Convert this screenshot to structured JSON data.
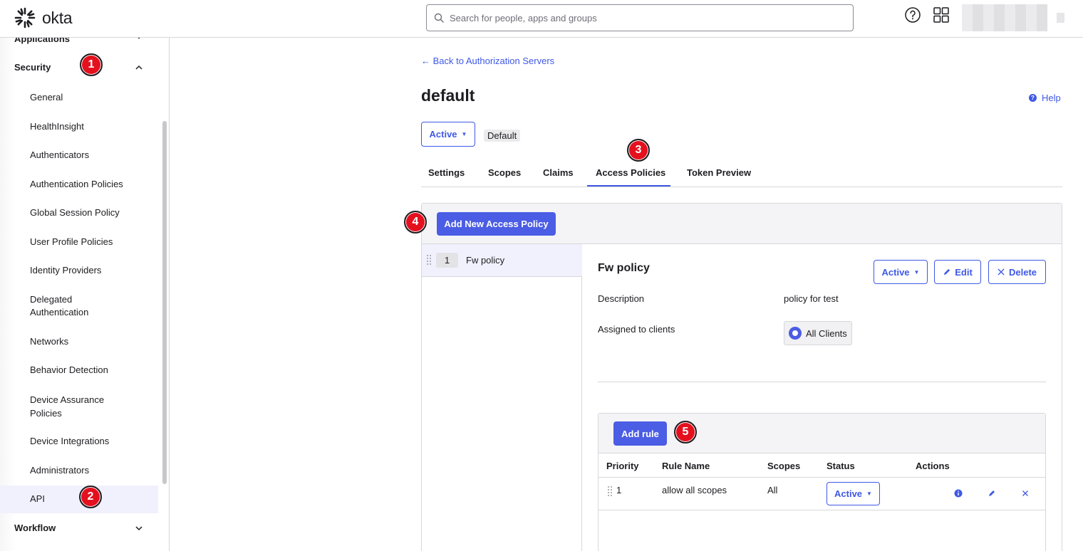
{
  "header": {
    "logo_text": "okta",
    "search_placeholder": "Search for people, apps and groups"
  },
  "sidebar": {
    "cut_section": "Applications",
    "security_label": "Security",
    "items": [
      "General",
      "HealthInsight",
      "Authenticators",
      "Authentication Policies",
      "Global Session Policy",
      "User Profile Policies",
      "Identity Providers",
      "Delegated Authentication",
      "Networks",
      "Behavior Detection",
      "Device Assurance Policies",
      "Device Integrations",
      "Administrators",
      "API"
    ],
    "active_item": "API",
    "workflow_label": "Workflow"
  },
  "badges": [
    "1",
    "2",
    "3",
    "4",
    "5"
  ],
  "main": {
    "back_link": "← Back to Authorization Servers",
    "title": "default",
    "help_label": "Help",
    "status_button": "Active",
    "default_tag": "Default",
    "tabs": [
      "Settings",
      "Scopes",
      "Claims",
      "Access Policies",
      "Token Preview"
    ],
    "active_tab": "Access Policies",
    "add_policy_button": "Add New Access Policy"
  },
  "policy_list": [
    {
      "priority": "1",
      "name": "Fw policy"
    }
  ],
  "policy_detail": {
    "name": "Fw policy",
    "status_button": "Active",
    "edit_button": "Edit",
    "delete_button": "Delete",
    "description_label": "Description",
    "description_value": "policy for test",
    "clients_label": "Assigned to clients",
    "clients_value": "All Clients"
  },
  "rules": {
    "add_rule_button": "Add rule",
    "columns": [
      "Priority",
      "Rule Name",
      "Scopes",
      "Status",
      "Actions"
    ],
    "rows": [
      {
        "priority": "1",
        "rule_name": "allow all scopes",
        "scopes": "All",
        "status": "Active"
      }
    ]
  },
  "colors": {
    "accent": "#3f59e4",
    "primary_button": "#4b5de4",
    "badge": "#e4101e"
  }
}
